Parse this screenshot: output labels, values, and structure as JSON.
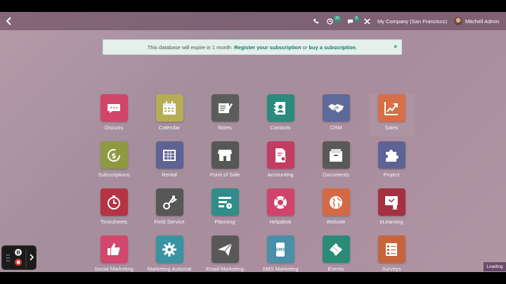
{
  "topbar": {
    "company": "My Company (San Francisco)",
    "user": "Mitchell Admin",
    "activity_count": "31",
    "messages_count": "5"
  },
  "banner": {
    "text_before": "This database will expire in 1 month.",
    "link1": "Register your subscription",
    "middle": "or",
    "link2": "buy a subscription",
    "after": ".",
    "close": "×"
  },
  "apps": [
    {
      "label": "Discuss",
      "color": "#d1456b",
      "icon": "chat-icon"
    },
    {
      "label": "Calendar",
      "color": "#b6ad55",
      "icon": "calendar-icon"
    },
    {
      "label": "Notes",
      "color": "#5c5c5c",
      "icon": "notes-icon"
    },
    {
      "label": "Contacts",
      "color": "#2a8b7e",
      "icon": "contacts-icon"
    },
    {
      "label": "CRM",
      "color": "#5e6a9a",
      "icon": "handshake-icon"
    },
    {
      "label": "Sales",
      "color": "#d66f47",
      "icon": "chart-up-icon"
    },
    {
      "label": "Subscriptions",
      "color": "#8e9a41",
      "icon": "subscription-icon"
    },
    {
      "label": "Rental",
      "color": "#5e6395",
      "icon": "rental-icon"
    },
    {
      "label": "Point of Sale",
      "color": "#575757",
      "icon": "shop-icon"
    },
    {
      "label": "Accounting",
      "color": "#c33d63",
      "icon": "accounting-icon"
    },
    {
      "label": "Documents",
      "color": "#595959",
      "icon": "documents-icon"
    },
    {
      "label": "Project",
      "color": "#5e6396",
      "icon": "puzzle-icon"
    },
    {
      "label": "Timesheets",
      "color": "#b53444",
      "icon": "stopwatch-icon"
    },
    {
      "label": "Field Service",
      "color": "#575757",
      "icon": "field-service-icon"
    },
    {
      "label": "Planning",
      "color": "#2f8d8a",
      "icon": "planning-icon"
    },
    {
      "label": "Helpdesk",
      "color": "#d0446c",
      "icon": "lifebuoy-icon"
    },
    {
      "label": "Website",
      "color": "#d36a43",
      "icon": "globe-icon"
    },
    {
      "label": "eLearning",
      "color": "#a53040",
      "icon": "elearning-icon"
    },
    {
      "label": "Social Marketing",
      "color": "#d2476d",
      "icon": "thumbs-up-icon"
    },
    {
      "label": "Marketing Automat",
      "color": "#3a93a1",
      "icon": "gear-icon"
    },
    {
      "label": "Email Marketing",
      "color": "#595959",
      "icon": "paper-plane-icon"
    },
    {
      "label": "SMS Marketing",
      "color": "#4a8fa8",
      "icon": "sms-icon"
    },
    {
      "label": "Events",
      "color": "#2a8b77",
      "icon": "ticket-icon"
    },
    {
      "label": "Surveys",
      "color": "#c8643d",
      "icon": "survey-icon"
    }
  ],
  "loading": "Loading"
}
